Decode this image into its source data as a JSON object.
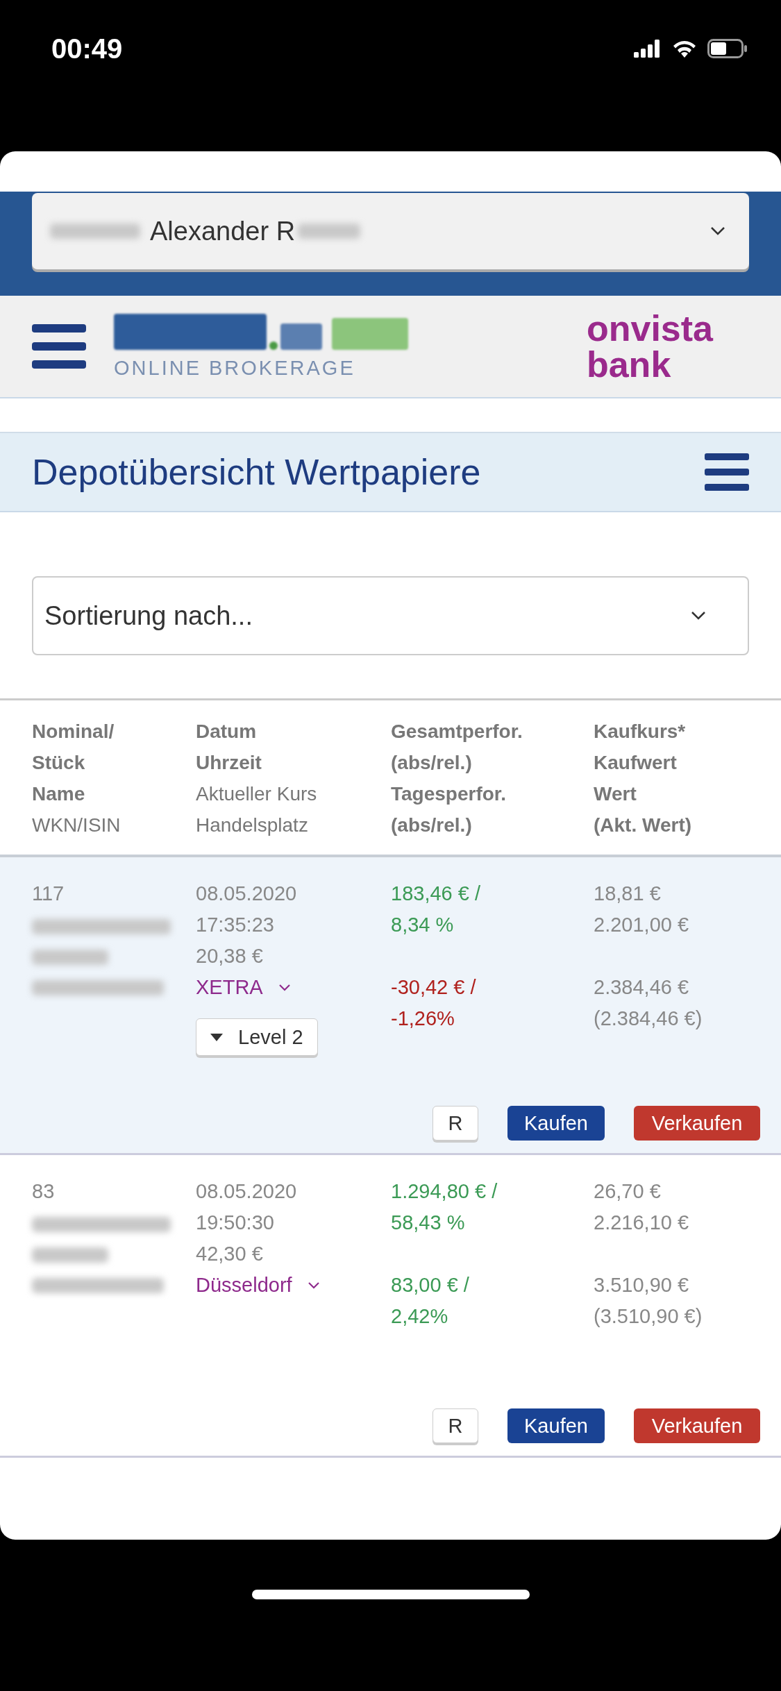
{
  "status_bar": {
    "time": "00:49"
  },
  "account_select": {
    "value": "Alexander R"
  },
  "brand": {
    "tagline": "ONLINE BROKERAGE",
    "bank_line_1": "onvista",
    "bank_line_2": "bank"
  },
  "page_title": "Depotübersicht Wertpapiere",
  "sort_select": {
    "placeholder": "Sortierung nach..."
  },
  "table": {
    "columns": [
      [
        {
          "text": "Nominal/",
          "bold": true
        },
        {
          "text": "Stück",
          "bold": true
        },
        {
          "text": "Name",
          "bold": true
        },
        {
          "text": "WKN/ISIN",
          "bold": false
        }
      ],
      [
        {
          "text": "Datum",
          "bold": true
        },
        {
          "text": "Uhrzeit",
          "bold": true
        },
        {
          "text": "Aktueller Kurs",
          "bold": false
        },
        {
          "text": "Handelsplatz",
          "bold": false
        }
      ],
      [
        {
          "text": "Gesamtperfor.",
          "bold": true
        },
        {
          "text": "(abs/rel.)",
          "bold": true
        },
        {
          "text": "Tagesperfor.",
          "bold": true
        },
        {
          "text": "(abs/rel.)",
          "bold": true
        }
      ],
      [
        {
          "text": "Kaufkurs*",
          "bold": true
        },
        {
          "text": "Kaufwert",
          "bold": true
        },
        {
          "text": "Wert",
          "bold": true
        },
        {
          "text": "(Akt. Wert)",
          "bold": true
        }
      ]
    ],
    "rows": [
      {
        "selected": true,
        "nominal": "117",
        "date": "08.05.2020",
        "time": "17:35:23",
        "price": "20,38 €",
        "venue": "XETRA",
        "total_perf": {
          "lines": [
            "183,46 € /",
            "8,34 %"
          ],
          "color": "#3b9a55"
        },
        "day_perf": {
          "lines": [
            "-30,42 € /",
            "-1,26%"
          ],
          "color": "#b0211d"
        },
        "buy_price": "18,81 €",
        "buy_value": "2.201,00 €",
        "value": "2.384,46 €",
        "current_value": "(2.384,46 €)",
        "level_button": "Level 2",
        "actions": [
          "R",
          "Kaufen",
          "Verkaufen"
        ]
      },
      {
        "selected": false,
        "nominal": "83",
        "date": "08.05.2020",
        "time": "19:50:30",
        "price": "42,30 €",
        "venue": "Düsseldorf",
        "total_perf": {
          "lines": [
            "1.294,80 € /",
            "58,43 %"
          ],
          "color": "#3b9a55"
        },
        "day_perf": {
          "lines": [
            "83,00 € /",
            "2,42%"
          ],
          "color": "#3b9a55"
        },
        "buy_price": "26,70 €",
        "buy_value": "2.216,10 €",
        "value": "3.510,90 €",
        "current_value": "(3.510,90 €)",
        "actions": [
          "R",
          "Kaufen",
          "Verkaufen"
        ]
      }
    ]
  }
}
